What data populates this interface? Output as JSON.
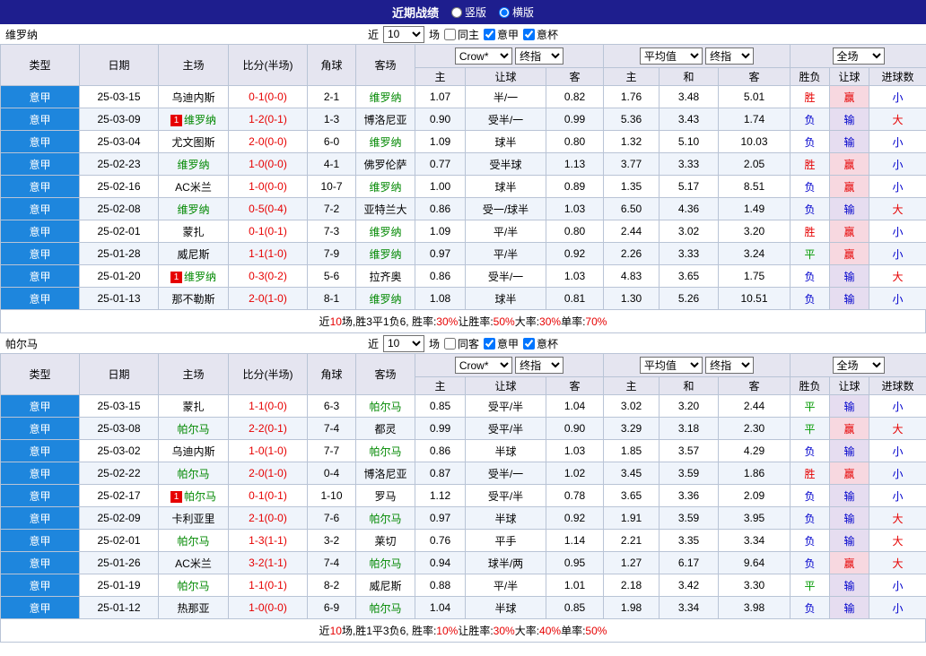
{
  "topbar": {
    "title": "近期战绩",
    "vertical_label": "竖版",
    "vertical_selected": false,
    "horizontal_label": "横版",
    "horizontal_selected": true
  },
  "labels": {
    "near": "近",
    "games": "场"
  },
  "colors": {
    "accent_red": "#e60000",
    "accent_blue": "#0000cc",
    "accent_green": "#009900",
    "focus_green": "#008800",
    "league_bg": "#1e86dd",
    "topbar_bg": "#1e1e8e",
    "handicap_win_bg": "#f7d8e0",
    "handicap_loss_bg": "#e6ddf0"
  },
  "table_header": {
    "type": "类型",
    "date": "日期",
    "home": "主场",
    "score": "比分(半场)",
    "corner": "角球",
    "away": "客场",
    "odds_company": "Crow*",
    "odds_period": "终指",
    "avg_label": "平均值",
    "avg_period": "终指",
    "scope": "全场",
    "home_odds": "主",
    "handicap": "让球",
    "away_odds": "客",
    "home_avg": "主",
    "draw_avg": "和",
    "away_avg": "客",
    "result": "胜负",
    "handicap_result": "让球",
    "goals": "进球数"
  },
  "sections": [
    {
      "team": "维罗纳",
      "controls": {
        "count": "10",
        "same_label": "同主",
        "same_checked": false,
        "league_label": "意甲",
        "league_checked": true,
        "cup_label": "意杯",
        "cup_checked": true
      },
      "rows": [
        {
          "league": "意甲",
          "date": "25-03-15",
          "home": "乌迪内斯",
          "home_focus": false,
          "home_badge": "",
          "away": "维罗纳",
          "away_focus": true,
          "away_badge": "",
          "score": "0-1(0-0)",
          "corner": "2-1",
          "odds": [
            "1.07",
            "半/一",
            "0.82"
          ],
          "avg": [
            "1.76",
            "3.48",
            "5.01"
          ],
          "result": "胜",
          "handicap_result": "赢",
          "goals": "小"
        },
        {
          "league": "意甲",
          "date": "25-03-09",
          "home": "维罗纳",
          "home_focus": true,
          "home_badge": "1",
          "away": "博洛尼亚",
          "away_focus": false,
          "away_badge": "",
          "score": "1-2(0-1)",
          "corner": "1-3",
          "odds": [
            "0.90",
            "受半/一",
            "0.99"
          ],
          "avg": [
            "5.36",
            "3.43",
            "1.74"
          ],
          "result": "负",
          "handicap_result": "输",
          "goals": "大"
        },
        {
          "league": "意甲",
          "date": "25-03-04",
          "home": "尤文图斯",
          "home_focus": false,
          "home_badge": "",
          "away": "维罗纳",
          "away_focus": true,
          "away_badge": "",
          "score": "2-0(0-0)",
          "corner": "6-0",
          "odds": [
            "1.09",
            "球半",
            "0.80"
          ],
          "avg": [
            "1.32",
            "5.10",
            "10.03"
          ],
          "result": "负",
          "handicap_result": "输",
          "goals": "小"
        },
        {
          "league": "意甲",
          "date": "25-02-23",
          "home": "维罗纳",
          "home_focus": true,
          "home_badge": "",
          "away": "佛罗伦萨",
          "away_focus": false,
          "away_badge": "",
          "score": "1-0(0-0)",
          "corner": "4-1",
          "odds": [
            "0.77",
            "受半球",
            "1.13"
          ],
          "avg": [
            "3.77",
            "3.33",
            "2.05"
          ],
          "result": "胜",
          "handicap_result": "赢",
          "goals": "小"
        },
        {
          "league": "意甲",
          "date": "25-02-16",
          "home": "AC米兰",
          "home_focus": false,
          "home_badge": "",
          "away": "维罗纳",
          "away_focus": true,
          "away_badge": "",
          "score": "1-0(0-0)",
          "corner": "10-7",
          "odds": [
            "1.00",
            "球半",
            "0.89"
          ],
          "avg": [
            "1.35",
            "5.17",
            "8.51"
          ],
          "result": "负",
          "handicap_result": "赢",
          "goals": "小"
        },
        {
          "league": "意甲",
          "date": "25-02-08",
          "home": "维罗纳",
          "home_focus": true,
          "home_badge": "",
          "away": "亚特兰大",
          "away_focus": false,
          "away_badge": "",
          "score": "0-5(0-4)",
          "corner": "7-2",
          "odds": [
            "0.86",
            "受一/球半",
            "1.03"
          ],
          "avg": [
            "6.50",
            "4.36",
            "1.49"
          ],
          "result": "负",
          "handicap_result": "输",
          "goals": "大"
        },
        {
          "league": "意甲",
          "date": "25-02-01",
          "home": "蒙扎",
          "home_focus": false,
          "home_badge": "",
          "away": "维罗纳",
          "away_focus": true,
          "away_badge": "",
          "score": "0-1(0-1)",
          "corner": "7-3",
          "odds": [
            "1.09",
            "平/半",
            "0.80"
          ],
          "avg": [
            "2.44",
            "3.02",
            "3.20"
          ],
          "result": "胜",
          "handicap_result": "赢",
          "goals": "小"
        },
        {
          "league": "意甲",
          "date": "25-01-28",
          "home": "威尼斯",
          "home_focus": false,
          "home_badge": "",
          "away": "维罗纳",
          "away_focus": true,
          "away_badge": "",
          "score": "1-1(1-0)",
          "corner": "7-9",
          "odds": [
            "0.97",
            "平/半",
            "0.92"
          ],
          "avg": [
            "2.26",
            "3.33",
            "3.24"
          ],
          "result": "平",
          "handicap_result": "赢",
          "goals": "小"
        },
        {
          "league": "意甲",
          "date": "25-01-20",
          "home": "维罗纳",
          "home_focus": true,
          "home_badge": "1",
          "away": "拉齐奥",
          "away_focus": false,
          "away_badge": "",
          "score": "0-3(0-2)",
          "corner": "5-6",
          "odds": [
            "0.86",
            "受半/一",
            "1.03"
          ],
          "avg": [
            "4.83",
            "3.65",
            "1.75"
          ],
          "result": "负",
          "handicap_result": "输",
          "goals": "大"
        },
        {
          "league": "意甲",
          "date": "25-01-13",
          "home": "那不勒斯",
          "home_focus": false,
          "home_badge": "",
          "away": "维罗纳",
          "away_focus": true,
          "away_badge": "",
          "score": "2-0(1-0)",
          "corner": "8-1",
          "odds": [
            "1.08",
            "球半",
            "0.81"
          ],
          "avg": [
            "1.30",
            "5.26",
            "10.51"
          ],
          "result": "负",
          "handicap_result": "输",
          "goals": "小"
        }
      ],
      "summary": [
        {
          "t": "近",
          "c": "k"
        },
        {
          "t": "10",
          "c": "r"
        },
        {
          "t": "场,胜3平1负6, 胜率:",
          "c": "k"
        },
        {
          "t": "30%",
          "c": "r"
        },
        {
          "t": " 让胜率:",
          "c": "k"
        },
        {
          "t": "50%",
          "c": "r"
        },
        {
          "t": " 大率:",
          "c": "k"
        },
        {
          "t": "30%",
          "c": "r"
        },
        {
          "t": " 单率:",
          "c": "k"
        },
        {
          "t": "70%",
          "c": "r"
        }
      ]
    },
    {
      "team": "帕尔马",
      "controls": {
        "count": "10",
        "same_label": "同客",
        "same_checked": false,
        "league_label": "意甲",
        "league_checked": true,
        "cup_label": "意杯",
        "cup_checked": true
      },
      "rows": [
        {
          "league": "意甲",
          "date": "25-03-15",
          "home": "蒙扎",
          "home_focus": false,
          "home_badge": "",
          "away": "帕尔马",
          "away_focus": true,
          "away_badge": "",
          "score": "1-1(0-0)",
          "corner": "6-3",
          "odds": [
            "0.85",
            "受平/半",
            "1.04"
          ],
          "avg": [
            "3.02",
            "3.20",
            "2.44"
          ],
          "result": "平",
          "handicap_result": "输",
          "goals": "小"
        },
        {
          "league": "意甲",
          "date": "25-03-08",
          "home": "帕尔马",
          "home_focus": true,
          "home_badge": "",
          "away": "都灵",
          "away_focus": false,
          "away_badge": "",
          "score": "2-2(0-1)",
          "corner": "7-4",
          "odds": [
            "0.99",
            "受平/半",
            "0.90"
          ],
          "avg": [
            "3.29",
            "3.18",
            "2.30"
          ],
          "result": "平",
          "handicap_result": "赢",
          "goals": "大"
        },
        {
          "league": "意甲",
          "date": "25-03-02",
          "home": "乌迪内斯",
          "home_focus": false,
          "home_badge": "",
          "away": "帕尔马",
          "away_focus": true,
          "away_badge": "",
          "score": "1-0(1-0)",
          "corner": "7-7",
          "odds": [
            "0.86",
            "半球",
            "1.03"
          ],
          "avg": [
            "1.85",
            "3.57",
            "4.29"
          ],
          "result": "负",
          "handicap_result": "输",
          "goals": "小"
        },
        {
          "league": "意甲",
          "date": "25-02-22",
          "home": "帕尔马",
          "home_focus": true,
          "home_badge": "",
          "away": "博洛尼亚",
          "away_focus": false,
          "away_badge": "",
          "score": "2-0(1-0)",
          "corner": "0-4",
          "odds": [
            "0.87",
            "受半/一",
            "1.02"
          ],
          "avg": [
            "3.45",
            "3.59",
            "1.86"
          ],
          "result": "胜",
          "handicap_result": "赢",
          "goals": "小"
        },
        {
          "league": "意甲",
          "date": "25-02-17",
          "home": "帕尔马",
          "home_focus": true,
          "home_badge": "1",
          "away": "罗马",
          "away_focus": false,
          "away_badge": "",
          "score": "0-1(0-1)",
          "corner": "1-10",
          "odds": [
            "1.12",
            "受平/半",
            "0.78"
          ],
          "avg": [
            "3.65",
            "3.36",
            "2.09"
          ],
          "result": "负",
          "handicap_result": "输",
          "goals": "小"
        },
        {
          "league": "意甲",
          "date": "25-02-09",
          "home": "卡利亚里",
          "home_focus": false,
          "home_badge": "",
          "away": "帕尔马",
          "away_focus": true,
          "away_badge": "",
          "score": "2-1(0-0)",
          "corner": "7-6",
          "odds": [
            "0.97",
            "半球",
            "0.92"
          ],
          "avg": [
            "1.91",
            "3.59",
            "3.95"
          ],
          "result": "负",
          "handicap_result": "输",
          "goals": "大"
        },
        {
          "league": "意甲",
          "date": "25-02-01",
          "home": "帕尔马",
          "home_focus": true,
          "home_badge": "",
          "away": "莱切",
          "away_focus": false,
          "away_badge": "",
          "score": "1-3(1-1)",
          "corner": "3-2",
          "odds": [
            "0.76",
            "平手",
            "1.14"
          ],
          "avg": [
            "2.21",
            "3.35",
            "3.34"
          ],
          "result": "负",
          "handicap_result": "输",
          "goals": "大"
        },
        {
          "league": "意甲",
          "date": "25-01-26",
          "home": "AC米兰",
          "home_focus": false,
          "home_badge": "",
          "away": "帕尔马",
          "away_focus": true,
          "away_badge": "",
          "score": "3-2(1-1)",
          "corner": "7-4",
          "odds": [
            "0.94",
            "球半/两",
            "0.95"
          ],
          "avg": [
            "1.27",
            "6.17",
            "9.64"
          ],
          "result": "负",
          "handicap_result": "赢",
          "goals": "大"
        },
        {
          "league": "意甲",
          "date": "25-01-19",
          "home": "帕尔马",
          "home_focus": true,
          "home_badge": "",
          "away": "威尼斯",
          "away_focus": false,
          "away_badge": "",
          "score": "1-1(0-1)",
          "corner": "8-2",
          "odds": [
            "0.88",
            "平/半",
            "1.01"
          ],
          "avg": [
            "2.18",
            "3.42",
            "3.30"
          ],
          "result": "平",
          "handicap_result": "输",
          "goals": "小"
        },
        {
          "league": "意甲",
          "date": "25-01-12",
          "home": "热那亚",
          "home_focus": false,
          "home_badge": "",
          "away": "帕尔马",
          "away_focus": true,
          "away_badge": "",
          "score": "1-0(0-0)",
          "corner": "6-9",
          "odds": [
            "1.04",
            "半球",
            "0.85"
          ],
          "avg": [
            "1.98",
            "3.34",
            "3.98"
          ],
          "result": "负",
          "handicap_result": "输",
          "goals": "小"
        }
      ],
      "summary": [
        {
          "t": "近",
          "c": "k"
        },
        {
          "t": "10",
          "c": "r"
        },
        {
          "t": "场,胜1平3负6, 胜率:",
          "c": "k"
        },
        {
          "t": "10%",
          "c": "r"
        },
        {
          "t": " 让胜率:",
          "c": "k"
        },
        {
          "t": "30%",
          "c": "r"
        },
        {
          "t": " 大率:",
          "c": "k"
        },
        {
          "t": "40%",
          "c": "r"
        },
        {
          "t": " 单率:",
          "c": "k"
        },
        {
          "t": "50%",
          "c": "r"
        }
      ]
    }
  ]
}
